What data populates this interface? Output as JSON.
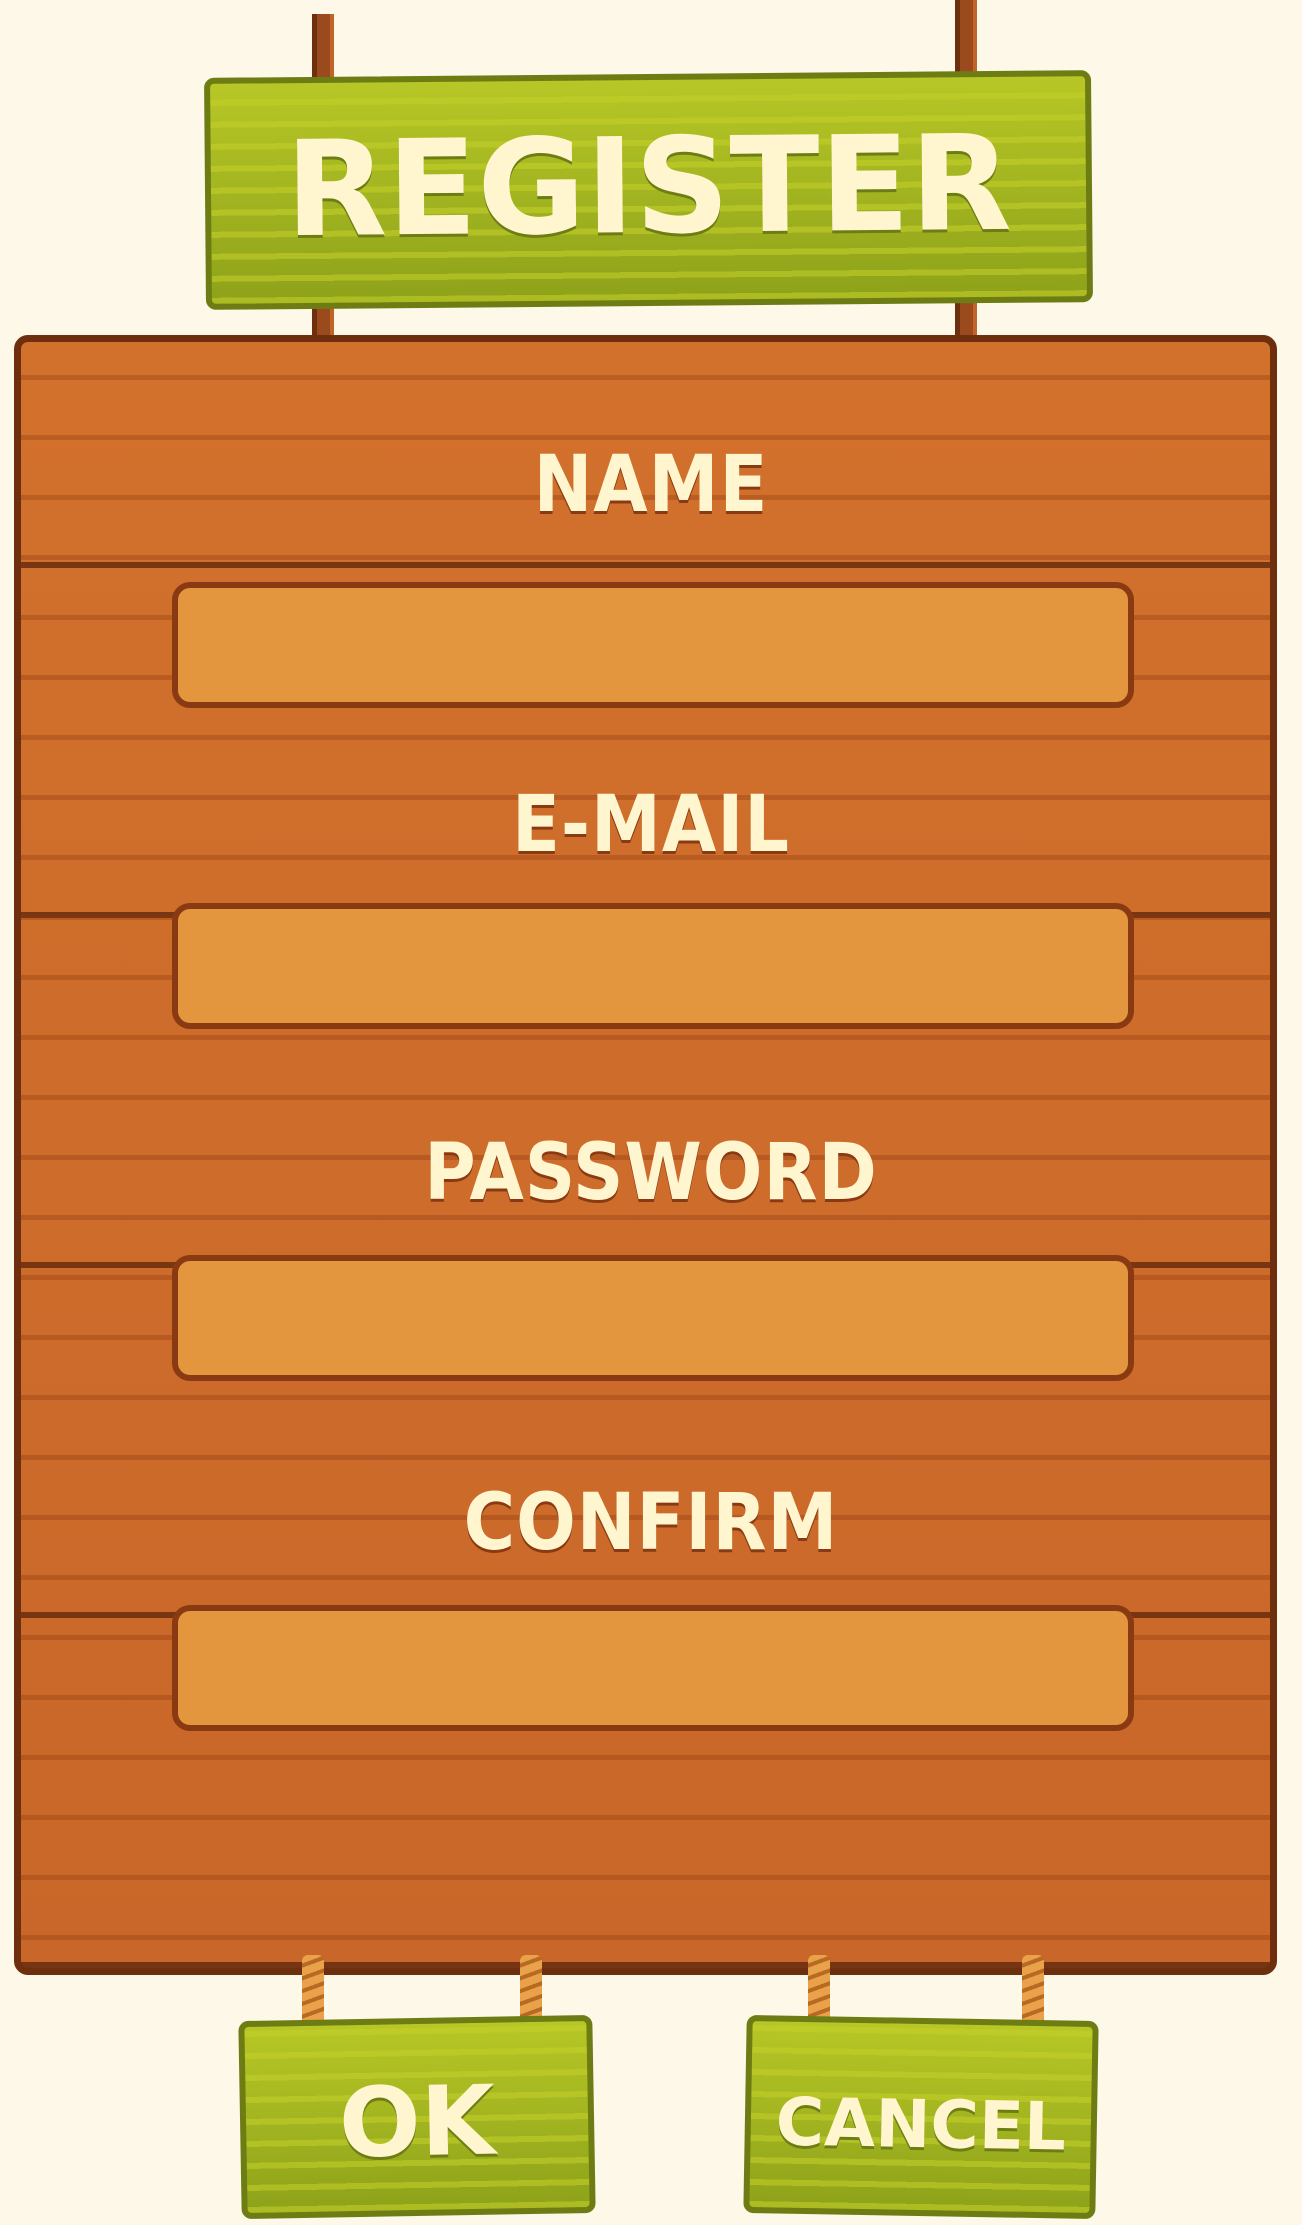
{
  "title": "REGISTER",
  "fields": [
    {
      "label": "NAME",
      "value": ""
    },
    {
      "label": "E-MAIL",
      "value": ""
    },
    {
      "label": "PASSWORD",
      "value": ""
    },
    {
      "label": "CONFIRM",
      "value": ""
    }
  ],
  "buttons": {
    "ok": "OK",
    "cancel": "CANCEL"
  },
  "colors": {
    "wood": "#cf6f2b",
    "wood_dark": "#6e2f0f",
    "field": "#e4963e",
    "green": "#9fb31d",
    "text": "#fff6cf",
    "background": "#fdf8e8"
  }
}
